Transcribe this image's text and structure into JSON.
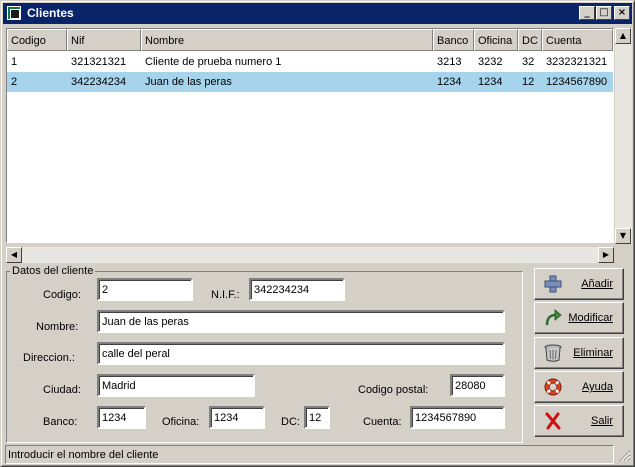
{
  "window": {
    "title": "Clientes",
    "controls": {
      "minimize": "_",
      "maximize": "□",
      "close": "×"
    }
  },
  "grid": {
    "columns": [
      "Codigo",
      "Nif",
      "Nombre",
      "Banco",
      "Oficina",
      "DC",
      "Cuenta"
    ],
    "rows": [
      {
        "codigo": "1",
        "nif": "321321321",
        "nombre": "Cliente de prueba numero 1",
        "banco": "3213",
        "oficina": "3232",
        "dc": "32",
        "cuenta": "3232321321"
      },
      {
        "codigo": "2",
        "nif": "342234234",
        "nombre": "Juan de las peras",
        "banco": "1234",
        "oficina": "1234",
        "dc": "12",
        "cuenta": "1234567890"
      }
    ],
    "selected_row": 2
  },
  "form": {
    "group_title": "Datos del cliente",
    "codigo_label": "Codigo:",
    "codigo_value": "2",
    "nif_label": "N.I.F.:",
    "nif_value": "342234234",
    "nombre_label": "Nombre:",
    "nombre_value": "Juan de las peras",
    "direccion_label": "Direccion.:",
    "direccion_value": "calle del peral",
    "ciudad_label": "Ciudad:",
    "ciudad_value": "Madrid",
    "cp_label": "Codigo postal:",
    "cp_value": "28080",
    "banco_label": "Banco:",
    "banco_value": "1234",
    "oficina_label": "Oficina:",
    "oficina_value": "1234",
    "dc_label": "DC:",
    "dc_value": "12",
    "cuenta_label": "Cuenta:",
    "cuenta_value": "1234567890"
  },
  "buttons": {
    "anadir": {
      "label": "Añadir",
      "icon": "plus-icon"
    },
    "modificar": {
      "label": "Modificar",
      "icon": "redo-arrow-icon"
    },
    "eliminar": {
      "label": "Eliminar",
      "icon": "trash-can-icon"
    },
    "ayuda": {
      "label": "Ayuda",
      "icon": "lifebuoy-icon"
    },
    "salir": {
      "label": "Salir",
      "icon": "red-x-icon"
    }
  },
  "statusbar": {
    "text": "Introducir el nombre del cliente"
  },
  "colors": {
    "titlebar": "#0a246a",
    "selection": "#a6d4ec",
    "face": "#d4d0c8"
  }
}
